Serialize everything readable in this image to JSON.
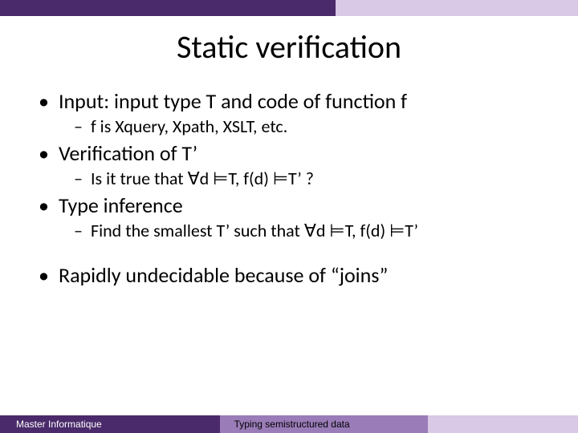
{
  "title": "Static verification",
  "bullets": {
    "b0": "Input: input type T and code of function f",
    "b0s0": "f is Xquery, Xpath, XSLT, etc.",
    "b1": "Verification of T’",
    "b1s0": "Is it true that ∀d ⊨T, f(d) ⊨T’ ?",
    "b2": "Type inference",
    "b2s0": "Find the smallest T’ such that ∀d ⊨T, f(d) ⊨T’",
    "b3": "Rapidly undecidable because of “joins”"
  },
  "footer": {
    "left": "Master Informatique",
    "mid": "Typing semistructured data"
  }
}
